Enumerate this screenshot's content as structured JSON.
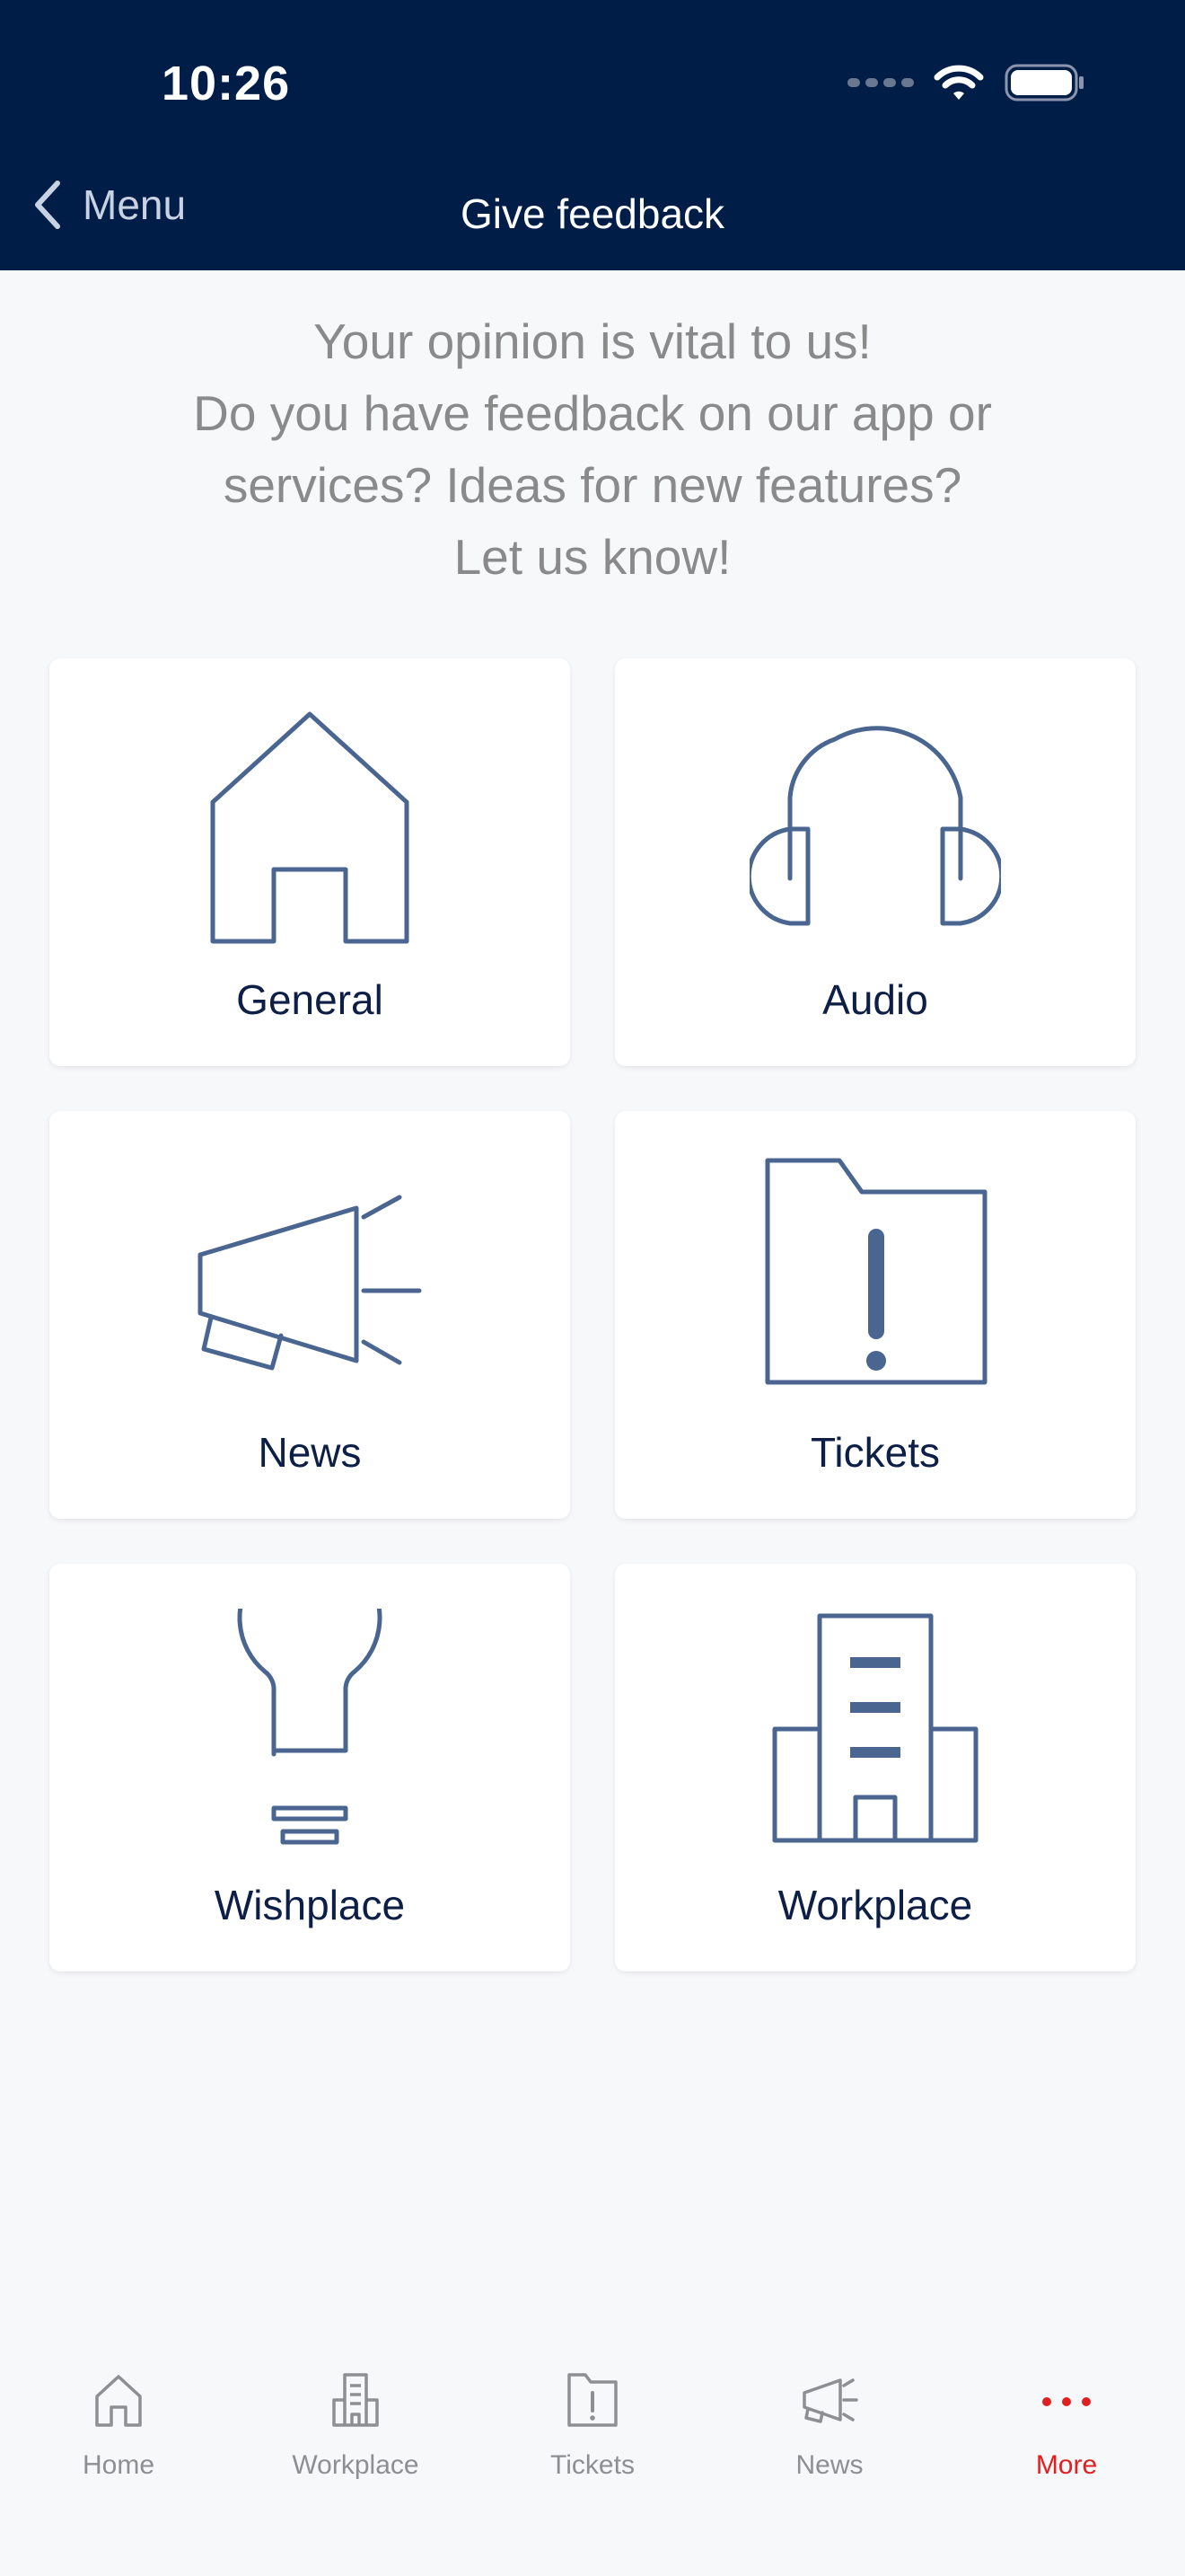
{
  "status_bar": {
    "time": "10:26"
  },
  "nav": {
    "back_label": "Menu",
    "title": "Give feedback"
  },
  "intro": {
    "lines": [
      "Your opinion is vital to us!",
      "Do you have feedback on our app or",
      "services? Ideas for new features?",
      "Let us know!"
    ]
  },
  "categories": [
    {
      "label": "General",
      "icon": "house-icon"
    },
    {
      "label": "Audio",
      "icon": "headphones-icon"
    },
    {
      "label": "News",
      "icon": "megaphone-icon"
    },
    {
      "label": "Tickets",
      "icon": "folder-alert-icon"
    },
    {
      "label": "Wishplace",
      "icon": "lightbulb-icon"
    },
    {
      "label": "Workplace",
      "icon": "building-icon"
    }
  ],
  "tabs": [
    {
      "label": "Home",
      "icon": "home-icon"
    },
    {
      "label": "Workplace",
      "icon": "building-icon"
    },
    {
      "label": "Tickets",
      "icon": "folder-alert-icon"
    },
    {
      "label": "News",
      "icon": "megaphone-icon"
    },
    {
      "label": "More",
      "icon": "more-dots-icon",
      "active": true
    }
  ],
  "colors": {
    "header_bg": "#001d48",
    "icon_stroke": "#4a6690",
    "active_tab": "#e02020",
    "inactive_tab": "#8e8e93"
  }
}
